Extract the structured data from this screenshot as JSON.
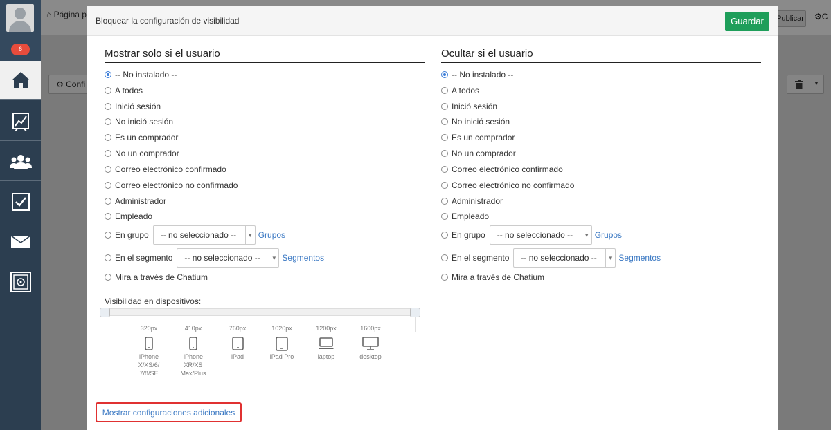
{
  "sidebar": {
    "badge": "6",
    "items": [
      {
        "icon": "home-icon",
        "active": true
      },
      {
        "icon": "chart-icon",
        "active": false
      },
      {
        "icon": "users-icon",
        "active": false
      },
      {
        "icon": "tasks-icon",
        "active": false
      },
      {
        "icon": "mail-icon",
        "active": false
      },
      {
        "icon": "safe-icon",
        "active": false
      }
    ]
  },
  "background": {
    "breadcrumb": "Página p",
    "publish_label": "Publicar",
    "config_right": "C",
    "config_button": "Confi"
  },
  "modal": {
    "title": "Bloquear la configuración de visibilidad",
    "save_label": "Guardar",
    "show_title": "Mostrar solo si el usuario",
    "hide_title": "Ocultar si el usuario",
    "options": [
      "-- No instalado --",
      "A todos",
      "Inició sesión",
      "No inició sesión",
      "Es un comprador",
      "No un comprador",
      "Correo electrónico confirmado",
      "Correo electrónico no confirmado",
      "Administrador",
      "Empleado"
    ],
    "group_label": "En grupo",
    "group_select": "-- no seleccionado --",
    "group_link": "Grupos",
    "segment_label": "En el segmento",
    "segment_select": "-- no seleccionado --",
    "segment_link": "Segmentos",
    "chatium_label": "Mira a través de Chatium",
    "devices_label": "Visibilidad en dispositivos:",
    "devices": [
      {
        "px": "320px",
        "name": "iPhone X/XS/6/ 7/8/SE",
        "icon": "phone-icon"
      },
      {
        "px": "410px",
        "name": "iPhone XR/XS Max/Plus",
        "icon": "phone-icon"
      },
      {
        "px": "760px",
        "name": "iPad",
        "icon": "tablet-icon"
      },
      {
        "px": "1020px",
        "name": "iPad Pro",
        "icon": "tablet-icon"
      },
      {
        "px": "1200px",
        "name": "laptop",
        "icon": "laptop-icon"
      },
      {
        "px": "1600px",
        "name": "desktop",
        "icon": "desktop-icon"
      }
    ],
    "more_link": "Mostrar configuraciones adicionales"
  }
}
